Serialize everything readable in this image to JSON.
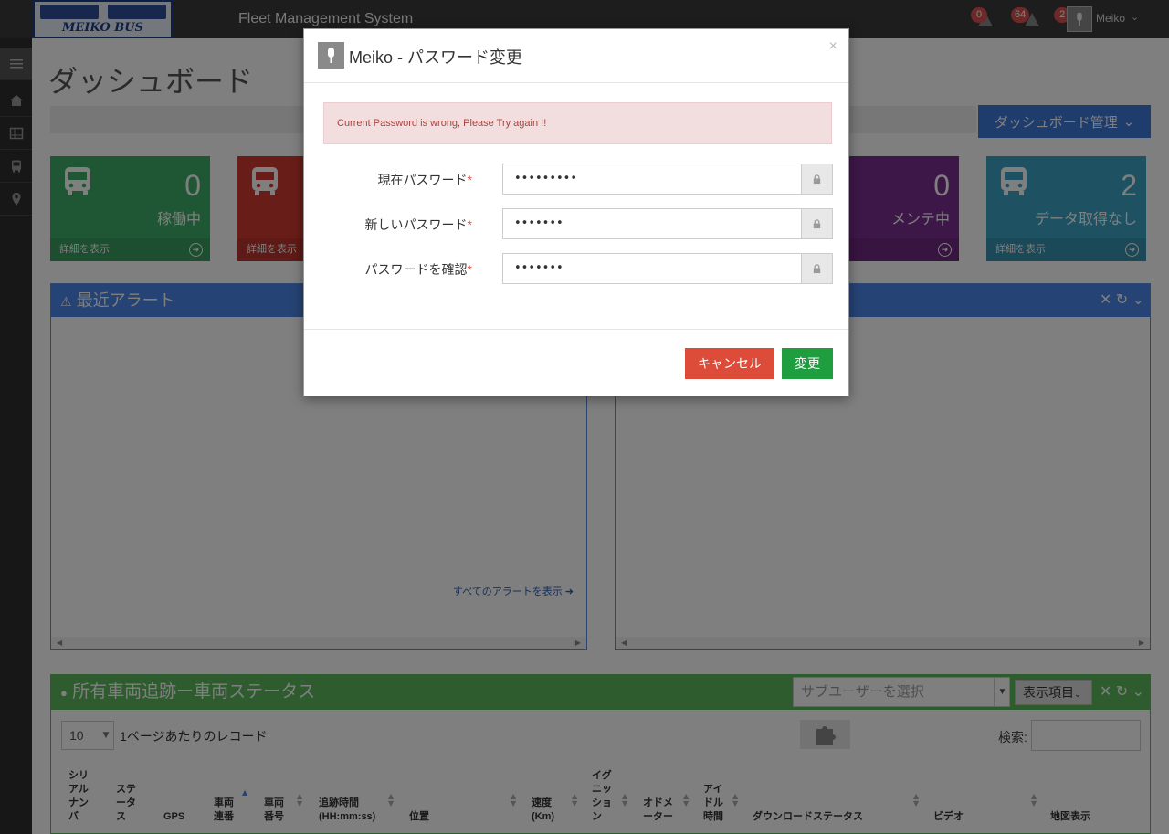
{
  "header": {
    "logo_text": "MEIKO BUS",
    "app_title": "Fleet Management System",
    "badges": {
      "alerts_a": "0",
      "alerts_b": "64",
      "notifications": "2"
    },
    "user_name": "Meiko"
  },
  "sidebar": {
    "icons": [
      "menu-icon",
      "home-icon",
      "table-icon",
      "bus-icon",
      "map-pin-icon"
    ]
  },
  "page": {
    "title": "ダッシュボード",
    "dashboard_manage_button": "ダッシュボード管理"
  },
  "tiles": [
    {
      "value": "0",
      "label": "稼働中",
      "footer": "詳細を表示",
      "color": "#3fae6a"
    },
    {
      "value": "",
      "label": "",
      "footer": "詳細を表示",
      "color": "#d23a31"
    },
    {
      "value": "0",
      "label": "メンテ中",
      "footer": "",
      "color": "#7b2f8f"
    },
    {
      "value": "2",
      "label": "データ取得なし",
      "footer": "詳細を表示",
      "color": "#3da4c4"
    }
  ],
  "alerts_panel": {
    "title": "最近アラート",
    "view_all": "すべてのアラートを表示"
  },
  "tracking_panel": {
    "title": "所有車両追跡ー車両ステータス",
    "subuser_placeholder": "サブユーザーを選択",
    "columns_button": "表示項目",
    "page_size": "10",
    "page_size_label": "1ページあたりのレコード",
    "search_label": "検索:",
    "columns": [
      "シリアルナンバ",
      "ステータス",
      "GPS",
      "車両連番",
      "車両番号",
      "追跡時間(HH:mm:ss)",
      "位置",
      "速度(Km)",
      "イグニッション",
      "オドメーター",
      "アイドル時間",
      "ダウンロードステータス",
      "ビデオ",
      "地図表示"
    ]
  },
  "modal": {
    "user": "Meiko",
    "title_suffix": "パスワード変更",
    "error": "Current Password is wrong, Please Try again !!",
    "fields": [
      {
        "label": "現在パスワード",
        "value": "•••••••••"
      },
      {
        "label": "新しいパスワード",
        "value": "•••••••"
      },
      {
        "label": "パスワードを確認",
        "value": "•••••••"
      }
    ],
    "required_mark": "*",
    "cancel_label": "キャンセル",
    "submit_label": "変更"
  }
}
